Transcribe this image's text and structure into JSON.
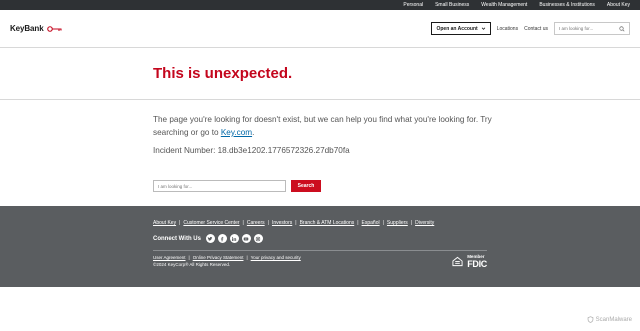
{
  "utility": {
    "links": [
      "Personal",
      "Small Business",
      "Wealth Management",
      "Businesses & Institutions",
      "About Key"
    ]
  },
  "header": {
    "logo_text": "KeyBank",
    "open_account": "Open an Account",
    "locations": "Locations",
    "contact": "Contact us",
    "search_placeholder": "I am looking for..."
  },
  "main": {
    "title": "This is unexpected.",
    "message_prefix": "The page you're looking for doesn't exist, but we can help you find what you're looking for. Try searching or go to ",
    "message_link": "Key.com",
    "message_suffix": ".",
    "incident": "Incident Number: 18.db3e1202.1776572326.27db70fa",
    "search_placeholder": "I am looking for...",
    "search_button": "Search"
  },
  "footer": {
    "links": [
      "About Key",
      "Customer Service Center",
      "Careers",
      "Investors",
      "Branch & ATM Locations",
      "Español",
      "Suppliers",
      "Diversity"
    ],
    "connect_label": "Connect With Us",
    "social_icons": [
      "twitter-icon",
      "facebook-icon",
      "linkedin-icon",
      "youtube-icon",
      "instagram-icon"
    ],
    "legal_links": [
      "User Agreement",
      "Online Privacy Statement",
      "Your privacy and security"
    ],
    "copyright": "©2024 KeyCorp® All Rights Reserved.",
    "fdic_member": "Member",
    "fdic_word": "FDIC"
  },
  "watermark": "ScanMalware",
  "colors": {
    "brand_red": "#c4061d",
    "utility_bg": "#2e3134",
    "footer_bg": "#5a5d60",
    "link_blue": "#0068a8"
  }
}
